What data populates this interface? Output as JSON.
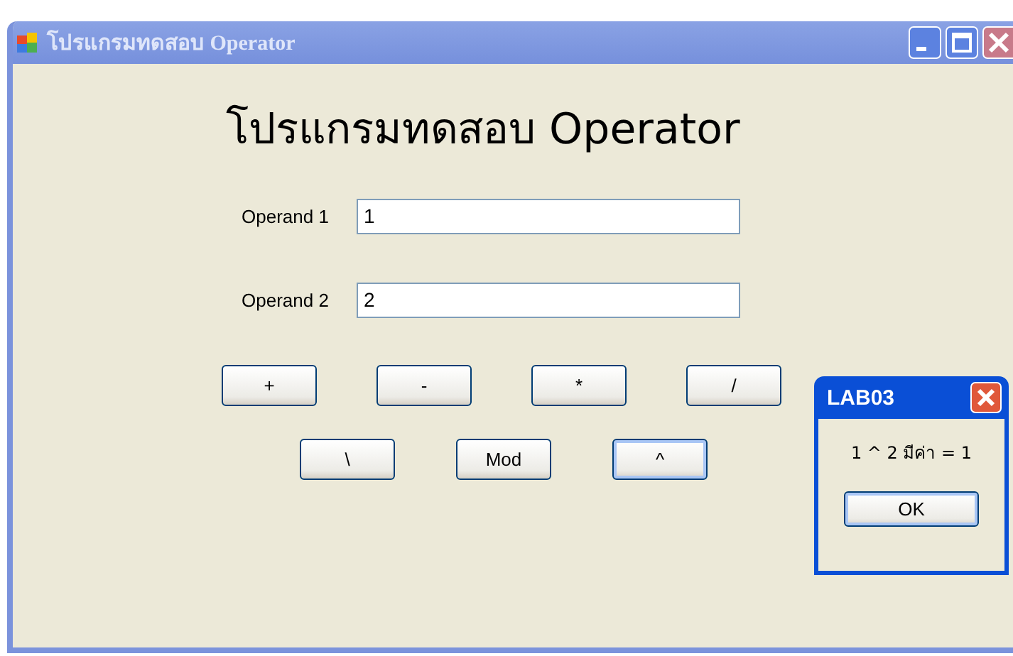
{
  "window": {
    "title": "โปรแกรมทดสอบ Operator",
    "active": false
  },
  "heading": "โปรแกรมทดสอบ Operator",
  "fields": [
    {
      "label": "Operand 1",
      "value": "1"
    },
    {
      "label": "Operand 2",
      "value": "2"
    }
  ],
  "button_rows": [
    [
      {
        "label": "+",
        "focused": false
      },
      {
        "label": "-",
        "focused": false
      },
      {
        "label": "*",
        "focused": false
      },
      {
        "label": "/",
        "focused": false
      }
    ],
    [
      {
        "label": "\\",
        "focused": false
      },
      {
        "label": "Mod",
        "focused": false
      },
      {
        "label": "^",
        "focused": true
      }
    ]
  ],
  "dialog": {
    "title": "LAB03",
    "message": "1 ^ 2 มีค่า = 1",
    "button": "OK"
  }
}
